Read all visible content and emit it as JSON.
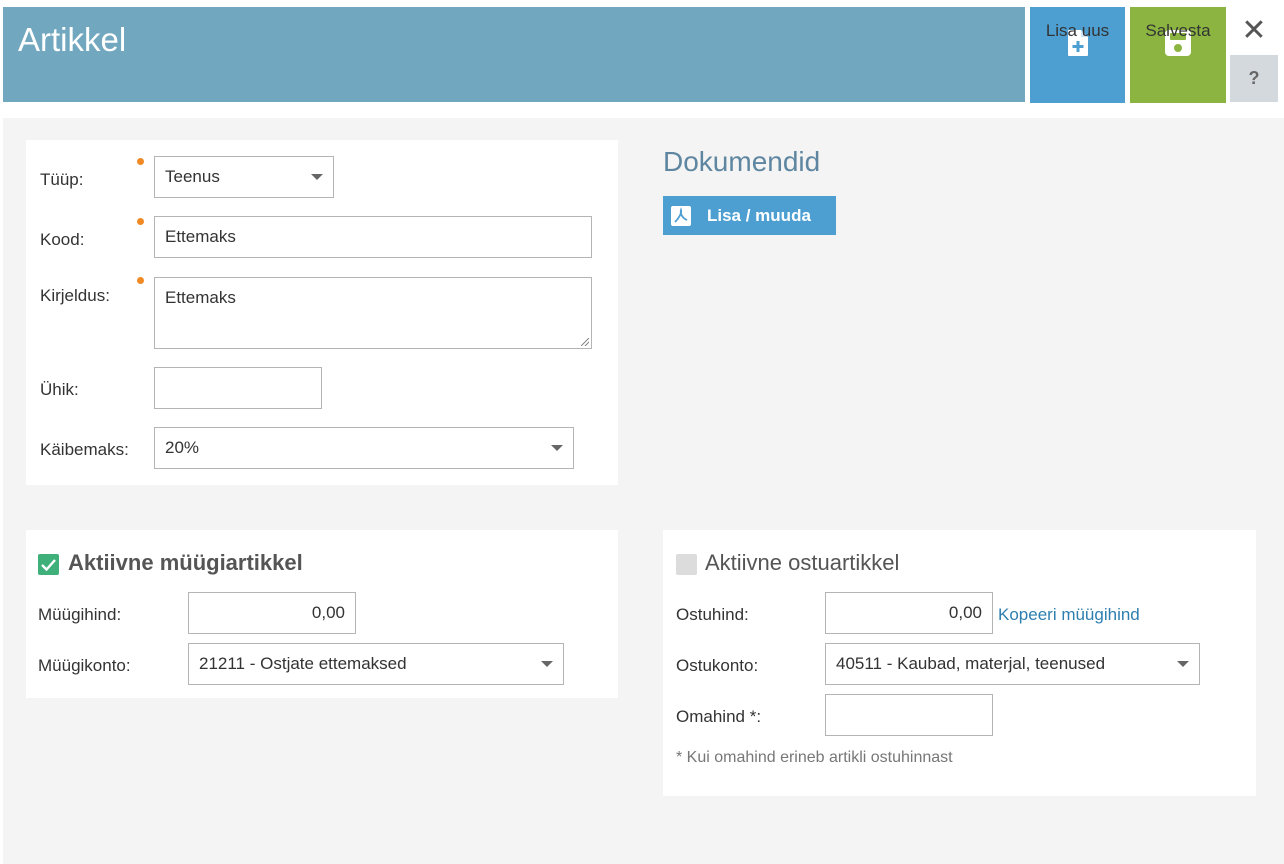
{
  "header": {
    "title": "Artikkel",
    "add_new_label": "Lisa uus",
    "save_label": "Salvesta",
    "close_glyph": "✕",
    "help_glyph": "?"
  },
  "main_form": {
    "type_label": "Tüüp:",
    "type_value": "Teenus",
    "code_label": "Kood:",
    "code_value": "Ettemaks",
    "description_label": "Kirjeldus:",
    "description_value": "Ettemaks",
    "unit_label": "Ühik:",
    "unit_value": "",
    "vat_label": "Käibemaks:",
    "vat_value": "20%"
  },
  "documents": {
    "title": "Dokumendid",
    "add_edit_label": "Lisa / muuda"
  },
  "sales": {
    "title": "Aktiivne müügiartikkel",
    "checked": true,
    "price_label": "Müügihind:",
    "price_value": "0,00",
    "account_label": "Müügikonto:",
    "account_value": "21211 - Ostjate ettemaksed"
  },
  "purchase": {
    "title": "Aktiivne ostuartikkel",
    "checked": false,
    "price_label": "Ostuhind:",
    "price_value": "0,00",
    "copy_link": "Kopeeri müügihind",
    "account_label": "Ostukonto:",
    "account_value": "40511 - Kaubad, materjal, teenused",
    "cost_label": "Omahind *:",
    "cost_value": "",
    "note": "* Kui omahind erineb artikli ostuhinnast"
  },
  "colors": {
    "header": "#72a8bf",
    "add_button": "#4d9fd1",
    "save_button": "#8bb540",
    "required_dot": "#f08a24",
    "checkbox_checked": "#3fb07a",
    "link": "#2e7fb0"
  }
}
